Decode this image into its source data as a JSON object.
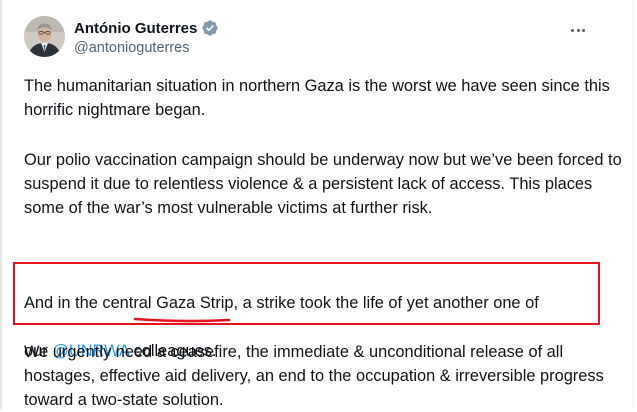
{
  "tweet": {
    "author": {
      "display_name": "António Guterres",
      "handle": "@antonioguterres",
      "verified": true,
      "avatar": "portrait-photo"
    },
    "more_icon": "more-horizontal-icon",
    "paragraphs": [
      "The humanitarian situation in northern Gaza is the worst we have seen since this horrific nightmare began.",
      "Our polio vaccination campaign should be underway now but we’ve been forced to suspend it due to relentless violence & a persistent lack of access. This places some of the war’s most vulnerable victims at further risk.",
      "We urgently need a ceasefire, the immediate & unconditional release of all hostages, effective aid delivery, an end to the occupation & irreversible progress toward a two-state solution."
    ],
    "highlighted_paragraph": {
      "line1": "And in the central Gaza Strip, a strike took the life of yet another one of",
      "line2_prefix": "our ",
      "mention": "@UNRWA",
      "line2_suffix": " colleagues."
    }
  },
  "colors": {
    "text": "#0f1419",
    "secondary_text": "#536471",
    "mention": "#1d9bf0",
    "verified_badge": "#829aab",
    "annotation_red": "#e8121f"
  }
}
